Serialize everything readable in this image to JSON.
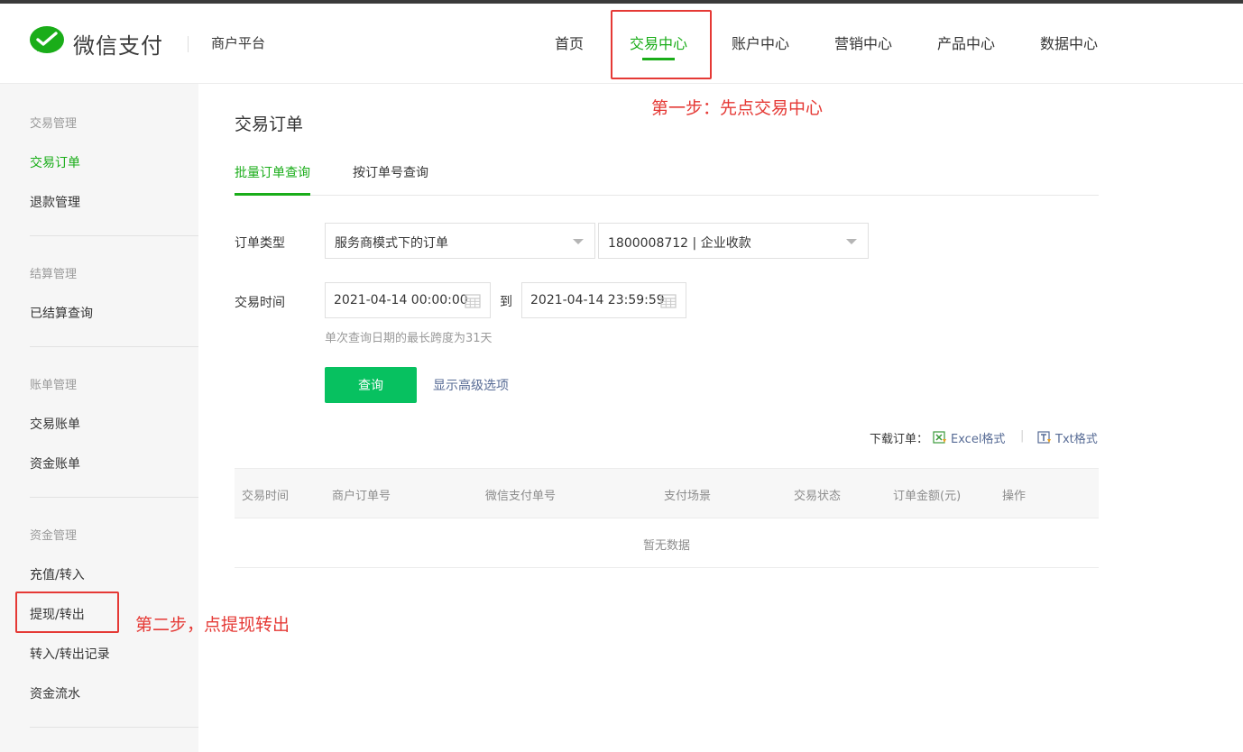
{
  "header": {
    "brand": "微信支付",
    "platform": "商户平台",
    "nav": [
      {
        "label": "首页",
        "active": false
      },
      {
        "label": "交易中心",
        "active": true
      },
      {
        "label": "账户中心",
        "active": false
      },
      {
        "label": "营销中心",
        "active": false
      },
      {
        "label": "产品中心",
        "active": false
      },
      {
        "label": "数据中心",
        "active": false
      }
    ]
  },
  "sidebar": {
    "groups": [
      {
        "title": "交易管理",
        "items": [
          "交易订单",
          "退款管理"
        ]
      },
      {
        "title": "结算管理",
        "items": [
          "已结算查询"
        ]
      },
      {
        "title": "账单管理",
        "items": [
          "交易账单",
          "资金账单"
        ]
      },
      {
        "title": "资金管理",
        "items": [
          "充值/转入",
          "提现/转出",
          "转入/转出记录",
          "资金流水"
        ]
      }
    ],
    "active_item": "交易订单"
  },
  "main": {
    "title": "交易订单",
    "tabs": [
      {
        "label": "批量订单查询",
        "active": true
      },
      {
        "label": "按订单号查询",
        "active": false
      }
    ],
    "form": {
      "order_type_label": "订单类型",
      "order_type_value": "服务商模式下的订单",
      "merchant_value": "1800008712 | 企业收款",
      "time_label": "交易时间",
      "start_time": "2021-04-14 00:00:00",
      "to_label": "到",
      "end_time": "2021-04-14 23:59:59",
      "hint": "单次查询日期的最长跨度为31天",
      "query_button": "查询",
      "advanced_link": "显示高级选项"
    },
    "download": {
      "label": "下载订单：",
      "excel": "Excel格式",
      "separator": "|",
      "txt": "Txt格式"
    },
    "table": {
      "columns": [
        "交易时间",
        "商户订单号",
        "微信支付单号",
        "支付场景",
        "交易状态",
        "订单金额(元)",
        "操作"
      ],
      "empty_text": "暂无数据"
    }
  },
  "annotations": {
    "step1": "第一步：先点交易中心",
    "step2": "第二步，点提现转出",
    "color": "#e53935"
  },
  "colors": {
    "accent": "#1aad19",
    "button": "#07c160",
    "link": "#576b95"
  }
}
